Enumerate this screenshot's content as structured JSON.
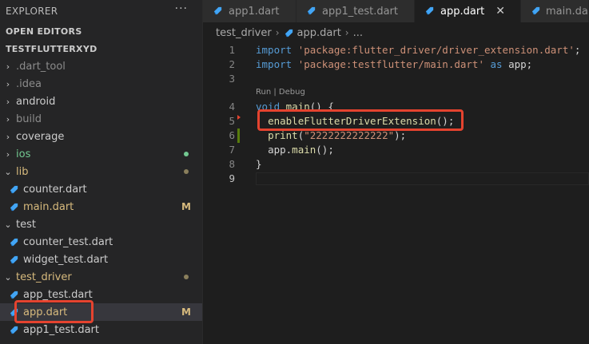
{
  "sidebar": {
    "title": "EXPLORER",
    "more": "···",
    "open_editors": "OPEN EDITORS",
    "project": "TESTFLUTTERXYD",
    "items": [
      {
        "label": ".dart_tool",
        "chev": "›",
        "color": "#8b8b8b"
      },
      {
        "label": ".idea",
        "chev": "›",
        "color": "#8b8b8b"
      },
      {
        "label": "android",
        "chev": "›",
        "color": "#cccccc"
      },
      {
        "label": "build",
        "chev": "›",
        "color": "#8b8b8b"
      },
      {
        "label": "coverage",
        "chev": "›",
        "color": "#cccccc"
      },
      {
        "label": "ios",
        "chev": "›",
        "color": "#73c991"
      },
      {
        "label": "lib",
        "chev": "⌄",
        "color": "#d7ba7d"
      },
      {
        "label": "counter.dart",
        "color": "#cccccc"
      },
      {
        "label": "main.dart",
        "color": "#d7ba7d",
        "badge": "M"
      },
      {
        "label": "test",
        "chev": "⌄",
        "color": "#cccccc"
      },
      {
        "label": "counter_test.dart",
        "color": "#cccccc"
      },
      {
        "label": "widget_test.dart",
        "color": "#cccccc"
      },
      {
        "label": "test_driver",
        "chev": "⌄",
        "color": "#d7ba7d"
      },
      {
        "label": "app_test.dart",
        "color": "#cccccc"
      },
      {
        "label": "app.dart",
        "color": "#d7ba7d",
        "badge": "M"
      },
      {
        "label": "app1_test.dart",
        "color": "#cccccc"
      }
    ]
  },
  "tabs": [
    {
      "label": "app1.dart"
    },
    {
      "label": "app1_test.dart"
    },
    {
      "label": "app.dart",
      "close": "✕"
    },
    {
      "label": "main.dart"
    }
  ],
  "breadcrumb": {
    "folder": "test_driver",
    "file": "app.dart",
    "more": "..."
  },
  "editor": {
    "codelens": "Run | Debug",
    "line_numbers": [
      "1",
      "2",
      "3",
      "4",
      "5",
      "6",
      "7",
      "8",
      "9"
    ],
    "line1": {
      "kw": "import",
      "str": "'package:flutter_driver/driver_extension.dart'",
      "end": ";"
    },
    "line2": {
      "kw": "import",
      "str": "'package:testflutter/main.dart'",
      "as": "as",
      "rest": " app;"
    },
    "line4": {
      "kw": "void",
      "fn": "main",
      "rest": "() {"
    },
    "line5": {
      "fn": "enableFlutterDriverExtension",
      "rest": "();"
    },
    "line6": {
      "fn": "print",
      "open": "(",
      "str": "\"2222222222222\"",
      "rest": ");"
    },
    "line7": {
      "pre": "app.",
      "fn": "main",
      "rest": "();"
    },
    "line8": {
      "text": "}"
    }
  },
  "colors": {
    "accent": "#e5432f",
    "modified": "#d7ba7d",
    "untracked": "#73c991",
    "dart": "#42a5f5"
  }
}
